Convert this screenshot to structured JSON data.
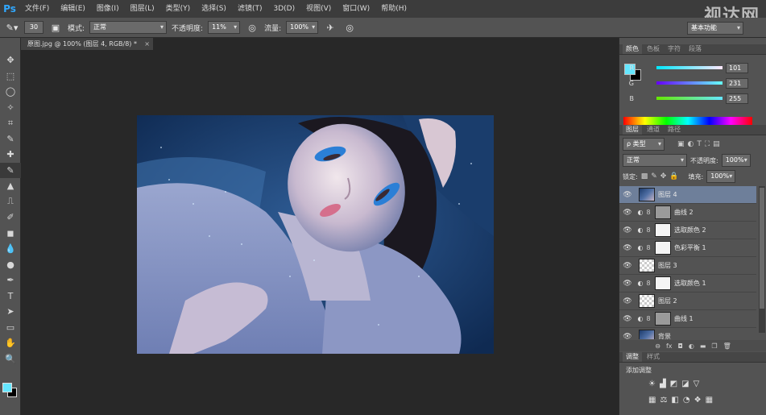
{
  "app": {
    "logo": "Ps",
    "watermark": "视达网"
  },
  "menu": [
    "文件(F)",
    "编辑(E)",
    "图像(I)",
    "图层(L)",
    "类型(Y)",
    "选择(S)",
    "滤镜(T)",
    "3D(D)",
    "视图(V)",
    "窗口(W)",
    "帮助(H)"
  ],
  "options": {
    "brush_size": "30",
    "mode_label": "模式:",
    "mode_value": "正常",
    "opacity_label": "不透明度:",
    "opacity_value": "11%",
    "flow_label": "流量:",
    "flow_value": "100%",
    "workspace": "基本功能"
  },
  "document": {
    "tab_title": "原图.jpg @ 100% (图层 4, RGB/8) *",
    "close": "×"
  },
  "color_panel": {
    "tabs": [
      "颜色",
      "色板",
      "字符",
      "段落"
    ],
    "r": {
      "label": "R",
      "value": "101"
    },
    "g": {
      "label": "G",
      "value": "231"
    },
    "b": {
      "label": "B",
      "value": "255"
    },
    "fg_color": "#65e7ff"
  },
  "layers_panel": {
    "tabs": [
      "图层",
      "通道",
      "路径"
    ],
    "filter_label": "ρ 类型",
    "blend_mode": "正常",
    "opacity_label": "不透明度:",
    "opacity_value": "100%",
    "lock_label": "锁定:",
    "fill_label": "填充:",
    "fill_value": "100%",
    "layers": [
      {
        "name": "图层 4",
        "type": "photo",
        "selected": true,
        "adjustment": false
      },
      {
        "name": "曲线 2",
        "type": "mask",
        "selected": false,
        "adjustment": true
      },
      {
        "name": "选取颜色 2",
        "type": "white",
        "selected": false,
        "adjustment": true
      },
      {
        "name": "色彩平衡 1",
        "type": "white",
        "selected": false,
        "adjustment": true
      },
      {
        "name": "图层 3",
        "type": "checker",
        "selected": false,
        "adjustment": false
      },
      {
        "name": "选取颜色 1",
        "type": "white",
        "selected": false,
        "adjustment": true
      },
      {
        "name": "图层 2",
        "type": "checker",
        "selected": false,
        "adjustment": false
      },
      {
        "name": "曲线 1",
        "type": "gray",
        "selected": false,
        "adjustment": true
      },
      {
        "name": "背景",
        "type": "photo",
        "selected": false,
        "adjustment": false
      }
    ],
    "footer_icons": [
      "link-icon",
      "fx-icon",
      "mask-icon",
      "adjustment-icon",
      "folder-icon",
      "new-layer-icon",
      "trash-icon"
    ],
    "footer_glyphs": [
      "⊖",
      "fx",
      "◘",
      "◐",
      "▬",
      "❐",
      "🗑"
    ]
  },
  "adjust_panel": {
    "tabs": [
      "调整",
      "样式"
    ],
    "title": "添加调整",
    "row1": [
      "☀",
      "▟",
      "◩",
      "◪",
      "▽"
    ],
    "row2": [
      "▦",
      "⚖",
      "◧",
      "◔",
      "❖",
      "▦"
    ]
  },
  "toolbar": [
    "✥",
    "⬚",
    "◯",
    "✧",
    "⌗",
    "✎",
    "✚",
    "✎",
    "▲",
    "⎍",
    "✐",
    "◼",
    "💧",
    "●",
    "✒",
    "T",
    "➤",
    "▭",
    "✋",
    "🔍"
  ]
}
